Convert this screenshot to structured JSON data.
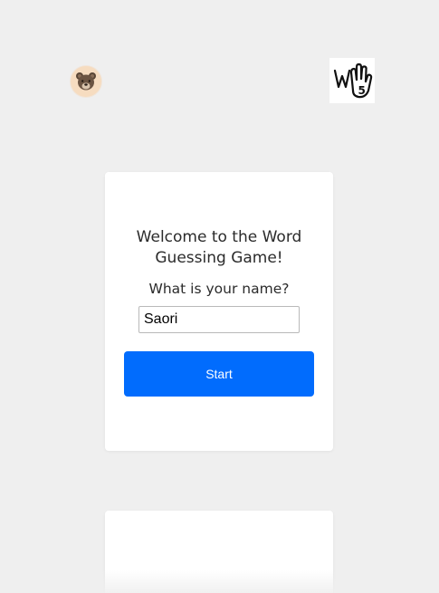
{
  "header": {
    "avatar_icon": "bear-avatar-icon",
    "logo_icon": "hand-w5-logo-icon"
  },
  "welcome_card": {
    "title": "Welcome to the Word Guessing Game!",
    "name_prompt": "What is your name?",
    "name_value": "Saori",
    "start_label": "Start"
  },
  "colors": {
    "background": "#efefef",
    "card": "#ffffff",
    "primary_button": "#016cfd",
    "avatar_bg": "#f6dcc0"
  }
}
